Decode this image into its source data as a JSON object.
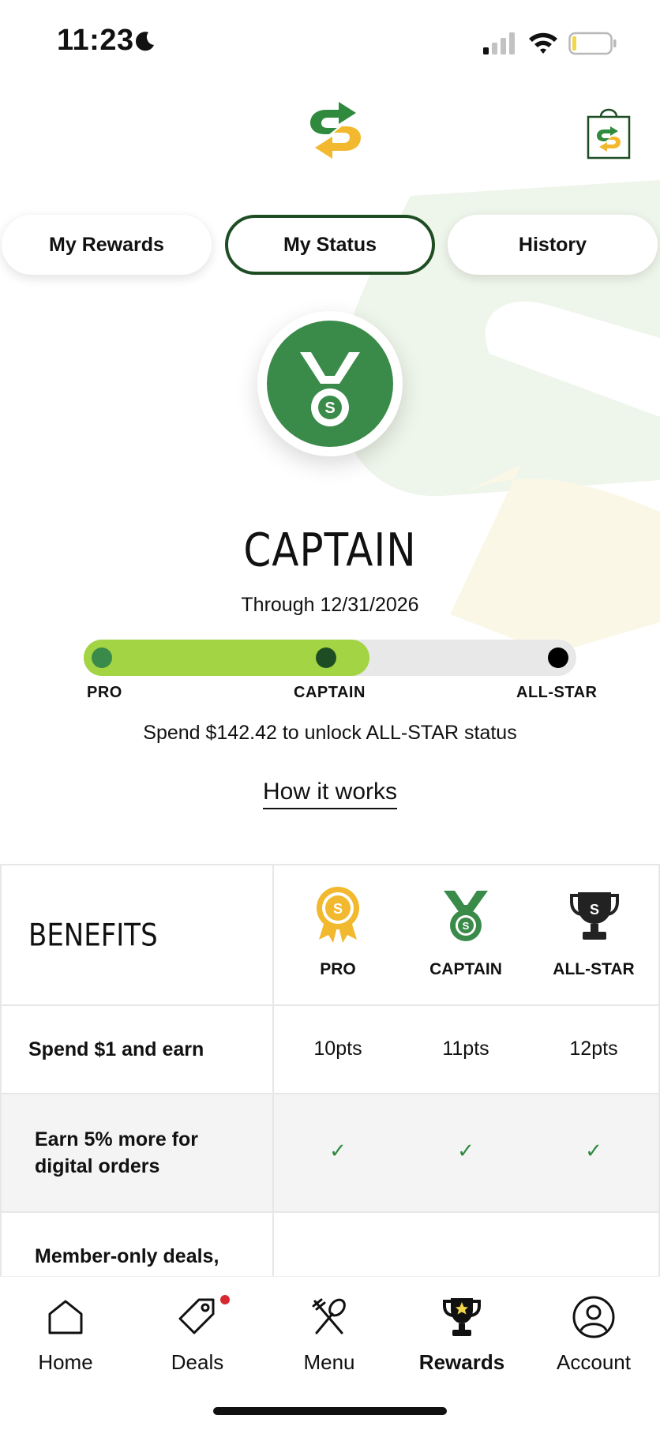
{
  "status_bar": {
    "time": "11:23"
  },
  "tabs": [
    {
      "label": "My Rewards"
    },
    {
      "label": "My Status"
    },
    {
      "label": "History"
    }
  ],
  "tier": {
    "name": "CAPTAIN",
    "through": "Through 12/31/2026",
    "progress_fraction": 0.58,
    "levels": [
      "PRO",
      "CAPTAIN",
      "ALL-STAR"
    ],
    "spend_text": "Spend $142.42 to unlock ALL-STAR status",
    "how_it_works": "How it works"
  },
  "benefits": {
    "title": "BENEFITS",
    "columns": [
      "PRO",
      "CAPTAIN",
      "ALL-STAR"
    ],
    "rows": [
      {
        "label": "Spend $1 and earn",
        "values": [
          "10pts",
          "11pts",
          "12pts"
        ]
      },
      {
        "label_lines": [
          "Earn 5% more for",
          "digital orders"
        ],
        "values": [
          "✓",
          "✓",
          "✓"
        ]
      },
      {
        "label_lines": [
          "Member-only deals,"
        ]
      }
    ]
  },
  "nav": [
    {
      "label": "Home",
      "icon": "home-icon"
    },
    {
      "label": "Deals",
      "icon": "tag-icon"
    },
    {
      "label": "Menu",
      "icon": "utensils-icon"
    },
    {
      "label": "Rewards",
      "icon": "trophy-icon"
    },
    {
      "label": "Account",
      "icon": "user-icon"
    }
  ],
  "colors": {
    "brand_green": "#3a8a4a",
    "dark_green": "#1e4d24",
    "progress_fill": "#a3d444",
    "brand_yellow": "#f2b82e",
    "notification_dot": "#d7282f"
  }
}
